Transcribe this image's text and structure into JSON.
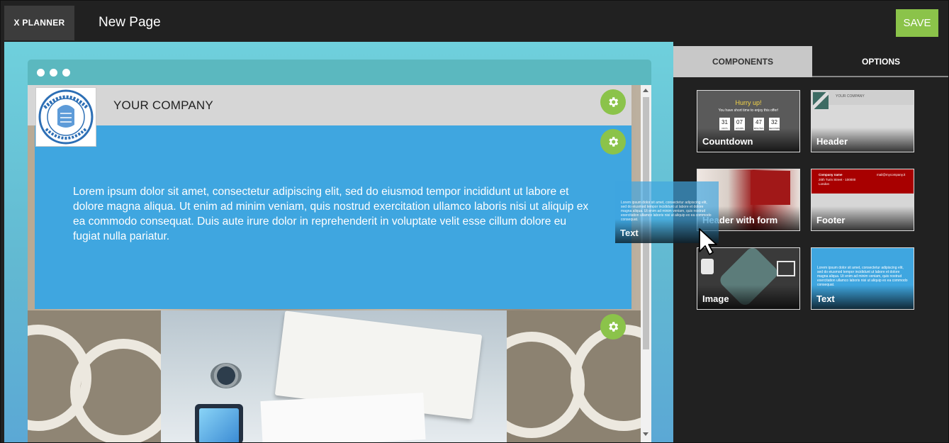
{
  "app": {
    "brand": "X PLANNER",
    "page_title": "New Page",
    "save_label": "SAVE"
  },
  "colors": {
    "accent": "#8bc34a",
    "text_block": "#3fa6e0",
    "canvas": "#6fd0dc",
    "footer_red": "#a80000"
  },
  "canvas": {
    "header": {
      "company_name": "YOUR COMPANY",
      "logo_icon": "university-seal-icon"
    },
    "text_block": {
      "body": "Lorem ipsum dolor sit amet, consectetur adipiscing elit, sed do eiusmod tempor incididunt ut labore et dolore magna aliqua. Ut enim ad minim veniam, quis nostrud exercitation ullamco laboris nisi ut aliquip ex ea commodo consequat. Duis aute irure dolor in reprehenderit in voluptate velit esse cillum dolore eu fugiat nulla pariatur."
    }
  },
  "panel": {
    "tabs": [
      {
        "label": "COMPONENTS",
        "active": true
      },
      {
        "label": "OPTIONS",
        "active": false
      }
    ],
    "components": [
      {
        "label": "Countdown"
      },
      {
        "label": "Header"
      },
      {
        "label": "Header with form"
      },
      {
        "label": "Footer"
      },
      {
        "label": "Image"
      },
      {
        "label": "Text"
      }
    ],
    "countdown_preview": {
      "title": "Hurry up!",
      "subtitle": "You have short time to enjoy this offer!",
      "units": [
        {
          "value": "31",
          "unit": "DAYS"
        },
        {
          "value": "07",
          "unit": "HOURS"
        },
        {
          "value": "47",
          "unit": "MINUTES"
        },
        {
          "value": "32",
          "unit": "SECONDS"
        }
      ]
    },
    "header_preview": {
      "company": "YOUR COMPANY"
    },
    "footer_preview": {
      "company": "Company name",
      "address": "20th Turin Street - 100000",
      "city": "London",
      "email": "mail@mycompany.it"
    },
    "text_preview": "Lorem ipsum dolor sit amet, consectetur adipiscing elit, sed do eiusmod tempor incididunt ut labore et dolore magna aliqua. Ut enim ad minim veniam, quis nostrud exercitation ullamco laboris nisi ut aliquip ex ea commodo consequat."
  },
  "drag": {
    "label": "Text",
    "preview": "Lorem ipsum dolor sit amet, consectetur adipiscing elit, sed do eiusmod tempor incididunt ut labore et dolore magna aliqua. Ut enim ad minim veniam, quis nostrud exercitation ullamco laboris nisi ut aliquip ex ea commodo consequat."
  }
}
